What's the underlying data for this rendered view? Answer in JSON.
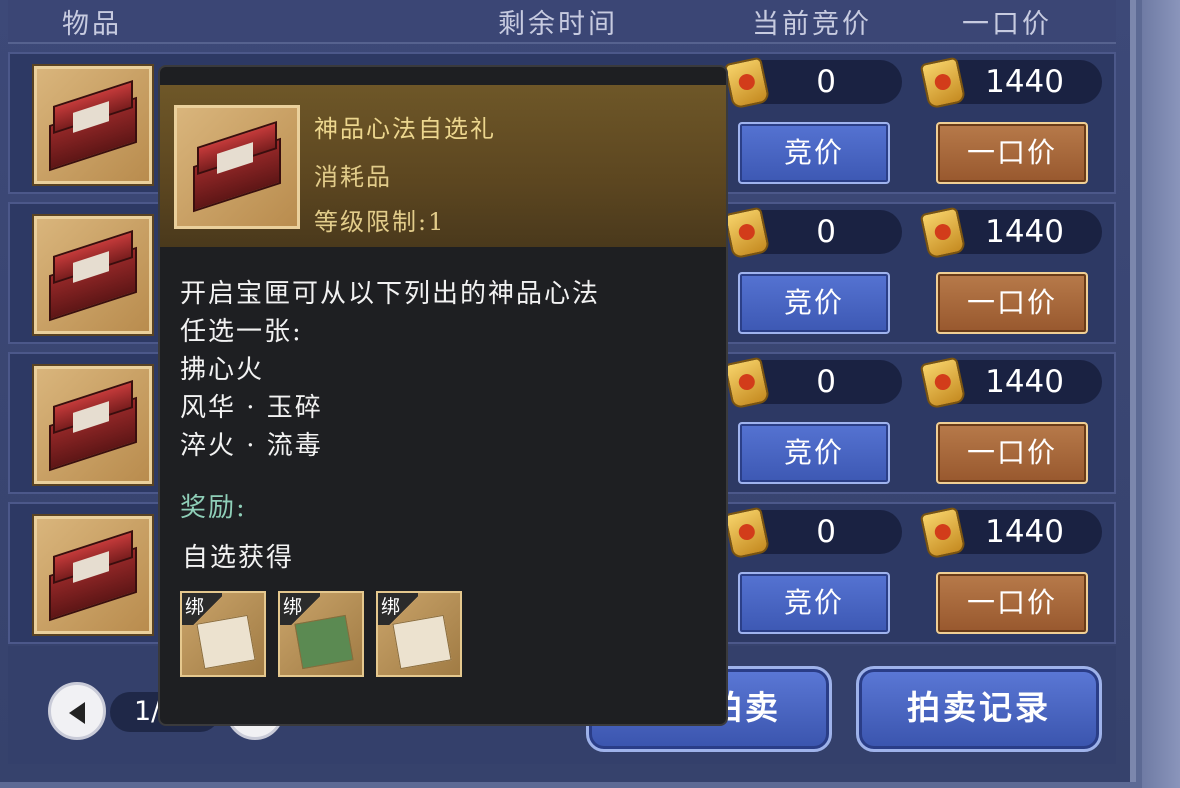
{
  "header": {
    "col_item": "物品",
    "col_time": "剩余时间",
    "col_bid": "当前竞价",
    "col_buyout": "一口价"
  },
  "rows": [
    {
      "current_bid": "0",
      "buyout": "1440",
      "bid_label": "竞价",
      "buyout_label": "一口价"
    },
    {
      "current_bid": "0",
      "buyout": "1440",
      "bid_label": "竞价",
      "buyout_label": "一口价"
    },
    {
      "current_bid": "0",
      "buyout": "1440",
      "bid_label": "竞价",
      "buyout_label": "一口价"
    },
    {
      "current_bid": "0",
      "buyout": "1440",
      "bid_label": "竞价",
      "buyout_label": "一口价"
    }
  ],
  "pagination": {
    "label": "1/"
  },
  "buttons": {
    "my_auction": "我的拍卖",
    "auction_record": "拍卖记录"
  },
  "tooltip": {
    "name": "神品心法自选礼",
    "type": "消耗品",
    "level": "等级限制:1",
    "desc_lines": [
      "开启宝匣可从以下列出的神品心法",
      "任选一张:",
      "拂心火",
      "风华 · 玉碎",
      "淬火 · 流毒"
    ],
    "reward_title": "奖励:",
    "reward_desc": "自选获得",
    "bind_label": "绑"
  },
  "icons": [
    "chest-icon",
    "gold-scroll-icon",
    "arrow-left-icon",
    "arrow-right-icon"
  ]
}
